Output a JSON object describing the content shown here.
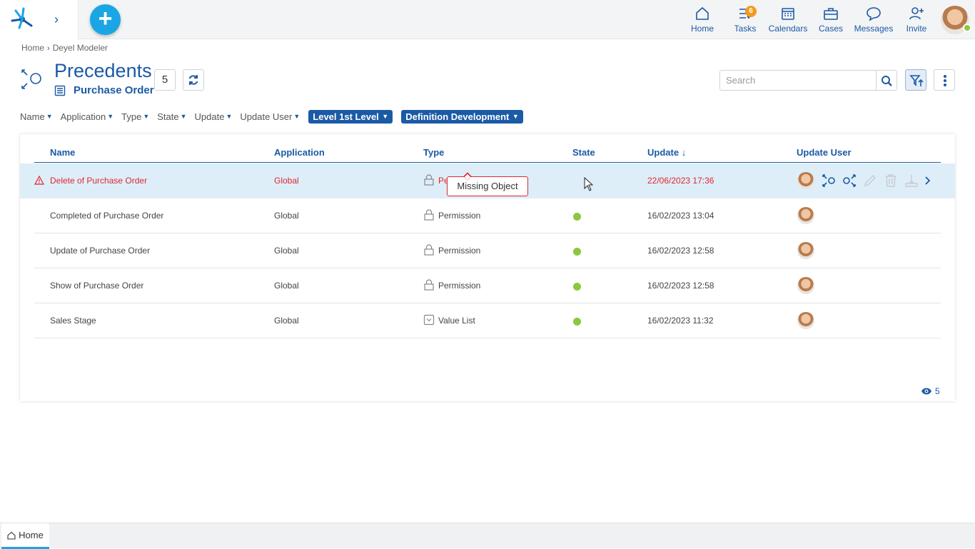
{
  "topbar": {
    "nav": [
      {
        "label": "Home",
        "icon": "home-icon"
      },
      {
        "label": "Tasks",
        "icon": "tasks-icon",
        "badge": "6"
      },
      {
        "label": "Calendars",
        "icon": "calendar-icon"
      },
      {
        "label": "Cases",
        "icon": "briefcase-icon"
      },
      {
        "label": "Messages",
        "icon": "chat-icon"
      },
      {
        "label": "Invite",
        "icon": "user-plus-icon"
      }
    ],
    "add_label": "+"
  },
  "breadcrumb": {
    "items": [
      "Home",
      "Deyel Modeler"
    ]
  },
  "header": {
    "title": "Precedents",
    "subtitle": "Purchase Order",
    "count": "5",
    "search_placeholder": "Search"
  },
  "filters": {
    "plain": [
      "Name",
      "Application",
      "Type",
      "State",
      "Update",
      "Update User"
    ],
    "active": [
      "Level 1st Level",
      "Definition Development"
    ]
  },
  "table": {
    "columns": [
      "Name",
      "Application",
      "Type",
      "State",
      "Update",
      "Update User"
    ],
    "sort_indicator": "↓",
    "rows": [
      {
        "name": "Delete of Purchase Order",
        "application": "Global",
        "type": "Pe",
        "type_icon": "lock-icon",
        "state": "",
        "update": "22/06/2023 17:36",
        "error": true
      },
      {
        "name": "Completed of Purchase Order",
        "application": "Global",
        "type": "Permission",
        "type_icon": "lock-icon",
        "state": "active",
        "update": "16/02/2023 13:04"
      },
      {
        "name": "Update of Purchase Order",
        "application": "Global",
        "type": "Permission",
        "type_icon": "lock-icon",
        "state": "active",
        "update": "16/02/2023 12:58"
      },
      {
        "name": "Show of Purchase Order",
        "application": "Global",
        "type": "Permission",
        "type_icon": "lock-icon",
        "state": "active",
        "update": "16/02/2023 12:58"
      },
      {
        "name": "Sales Stage",
        "application": "Global",
        "type": "Value List",
        "type_icon": "value-list-icon",
        "state": "active",
        "update": "16/02/2023 11:32"
      }
    ]
  },
  "tooltip": {
    "text": "Missing Object"
  },
  "footer": {
    "visible_count": "5"
  },
  "bottom_tabs": [
    {
      "label": "Home"
    }
  ],
  "colors": {
    "accent": "#1b5aa5",
    "brand": "#1aa6e4",
    "error": "#e0262e",
    "active_state": "#8dc63f",
    "badge": "#f29b1d"
  }
}
